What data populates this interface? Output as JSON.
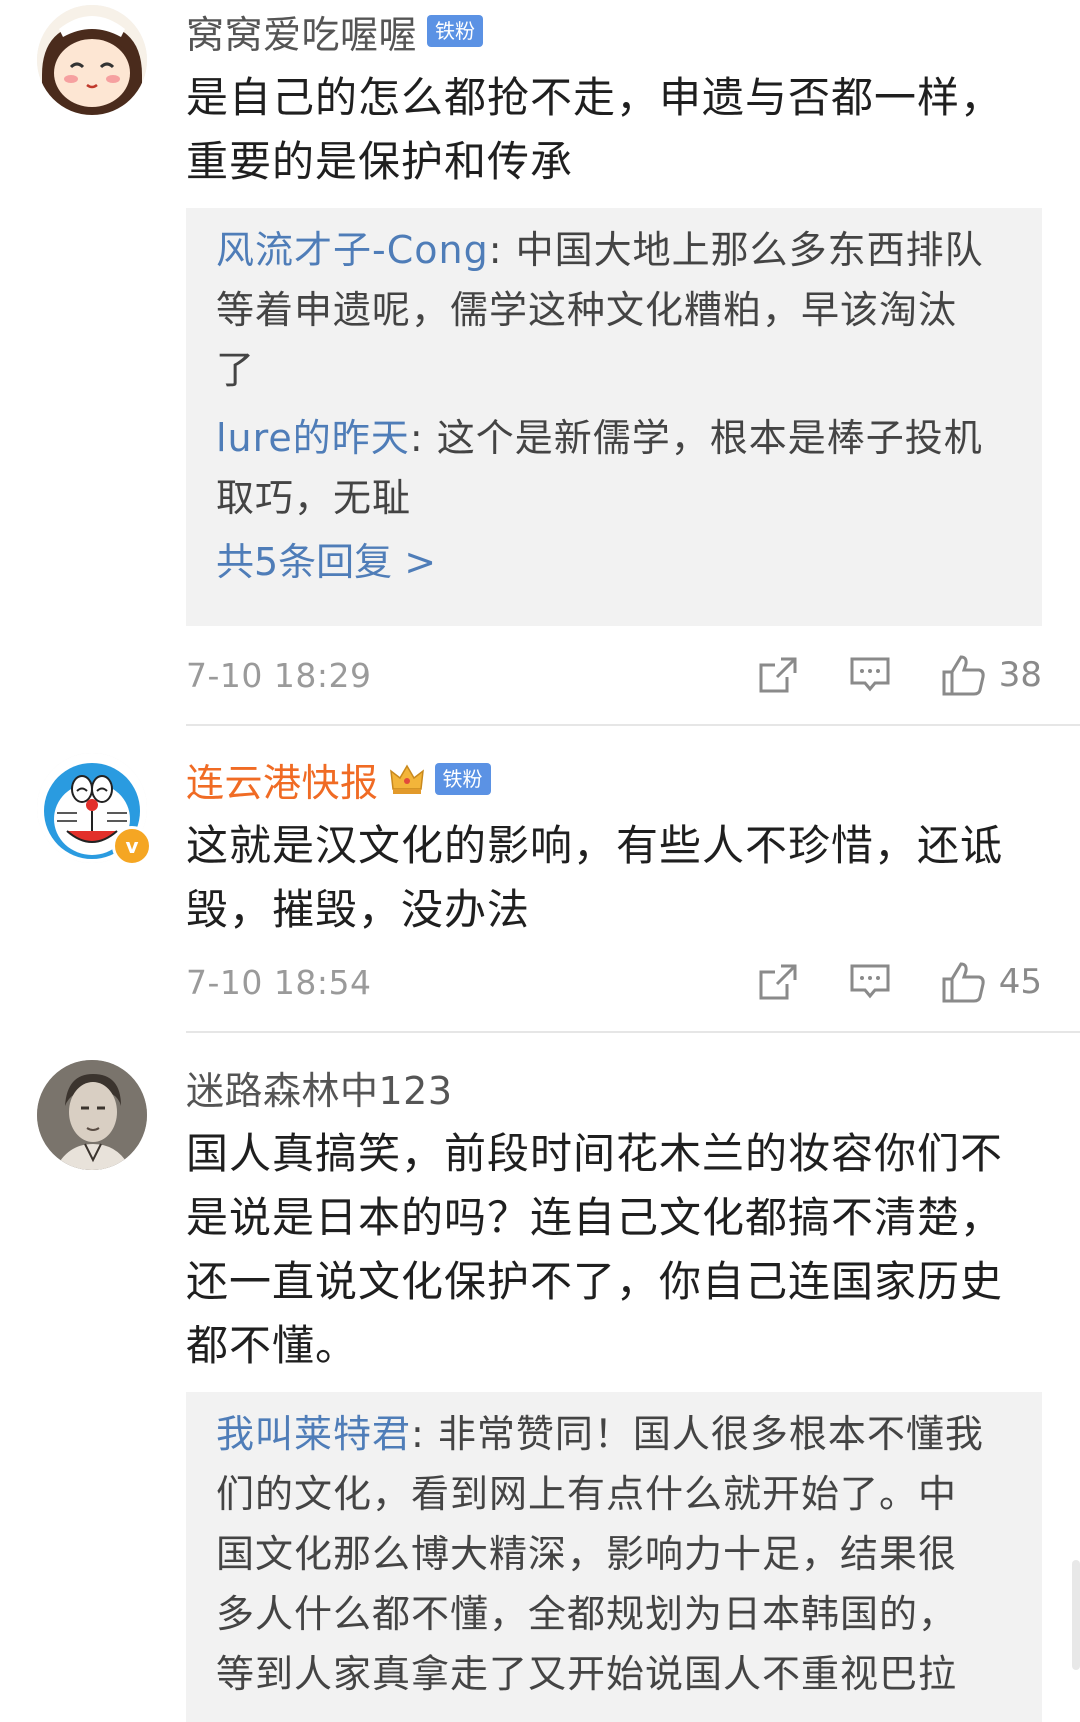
{
  "comments": [
    {
      "username": "窝窝爱吃喔喔",
      "badge": "铁粉",
      "text_lines": [
        "是自己的怎么都抢不走，申遗与否都一样，",
        "重要的是保护和传承"
      ],
      "replies": [
        {
          "name": "风流才子-Cong",
          "line1": ": 中国大地上那么多东西排队",
          "line2": "等着申遗呢，儒学这种文化糟粕，早该淘汰",
          "line3": "了"
        },
        {
          "name": "lure的昨天",
          "line1": ": 这个是新儒学，根本是棒子投机",
          "line2": "取巧，无耻"
        }
      ],
      "more_replies": "共5条回复 >",
      "time": "7-10 18:29",
      "likes": "38"
    },
    {
      "username": "连云港快报",
      "badge": "铁粉",
      "verified_mark": "v",
      "text_lines": [
        "这就是汉文化的影响，有些人不珍惜，还诋",
        "毁，摧毁，没办法"
      ],
      "time": "7-10 18:54",
      "likes": "45"
    },
    {
      "username": "迷路森林中123",
      "text_lines": [
        "国人真搞笑，前段时间花木兰的妆容你们不",
        "是说是日本的吗？连自己文化都搞不清楚，",
        "还一直说文化保护不了，你自己连国家历史",
        "都不懂。"
      ],
      "replies": [
        {
          "name": "我叫莱特君",
          "line1": ": 非常赞同！国人很多根本不懂我",
          "line2": "们的文化，看到网上有点什么就开始了。中",
          "line3": "国文化那么博大精深，影响力十足，结果很",
          "line4": "多人什么都不懂，全都规划为日本韩国的，",
          "line5": "等到人家真拿走了又开始说国人不重视巴拉"
        }
      ]
    }
  ],
  "colors": {
    "link_blue": "#4f7db8",
    "orange_name": "#f06b24",
    "badge_blue": "#5b92e4",
    "reply_bg": "#f2f2f2",
    "meta_gray": "#9a9a9a"
  },
  "icons": [
    "share-icon",
    "comment-icon",
    "like-icon",
    "crown-icon",
    "verified-icon"
  ]
}
